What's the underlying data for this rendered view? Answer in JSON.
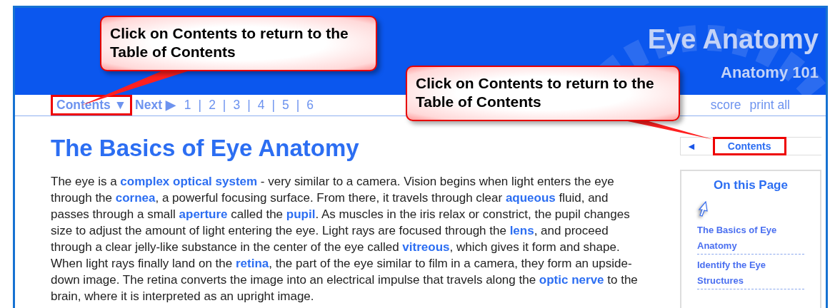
{
  "header": {
    "title": "Eye Anatomy",
    "subtitle": "Anatomy 101"
  },
  "nav": {
    "contents": {
      "label": "Contents",
      "arrow": "▼",
      "highlighted": true
    },
    "next": {
      "label": "Next",
      "arrow": "▶"
    },
    "separator": "|",
    "pages": [
      "1",
      "2",
      "3",
      "4",
      "5",
      "6"
    ],
    "right_links": [
      "score",
      "print all"
    ]
  },
  "article": {
    "title": "The Basics of Eye Anatomy",
    "paragraph": [
      {
        "kind": "text",
        "text": "The eye is a "
      },
      {
        "kind": "link",
        "text": "complex optical system"
      },
      {
        "kind": "text",
        "text": " - very similar to a camera. Vision begins when light enters the eye through the "
      },
      {
        "kind": "link",
        "text": "cornea"
      },
      {
        "kind": "text",
        "text": ", a powerful focusing surface. From there, it travels through clear "
      },
      {
        "kind": "link",
        "text": "aqueous"
      },
      {
        "kind": "text",
        "text": " fluid, and passes through a small "
      },
      {
        "kind": "link",
        "text": "aperture"
      },
      {
        "kind": "text",
        "text": " called the "
      },
      {
        "kind": "link",
        "text": "pupil"
      },
      {
        "kind": "text",
        "text": ". As muscles in the iris relax or constrict, the pupil changes size to adjust the amount of light entering the eye. Light rays are focused through the "
      },
      {
        "kind": "link",
        "text": "lens"
      },
      {
        "kind": "text",
        "text": ", and proceed through a clear jelly-like substance in the center of the eye called "
      },
      {
        "kind": "link",
        "text": "vitreous"
      },
      {
        "kind": "text",
        "text": ", which gives it form and shape. When light rays finally land on the "
      },
      {
        "kind": "link",
        "text": "retina"
      },
      {
        "kind": "text",
        "text": ", the part of the eye similar to film in a camera, they form an upside-down image. The retina converts the image into an electrical impulse that travels along the "
      },
      {
        "kind": "link",
        "text": "optic nerve"
      },
      {
        "kind": "text",
        "text": " to the brain, where it is interpreted as an upright image."
      }
    ]
  },
  "sidebar": {
    "back_arrow": "◄",
    "contents": {
      "label": "Contents",
      "highlighted": true
    },
    "on_this_page": {
      "title": "On this Page",
      "links": [
        "The Basics of Eye Anatomy",
        "Identify the Eye Structures"
      ]
    }
  },
  "callouts": [
    {
      "text": "Click on Contents to return to the Table of Contents"
    },
    {
      "text": "Click on Contents to return to the Table of Contents"
    }
  ]
}
